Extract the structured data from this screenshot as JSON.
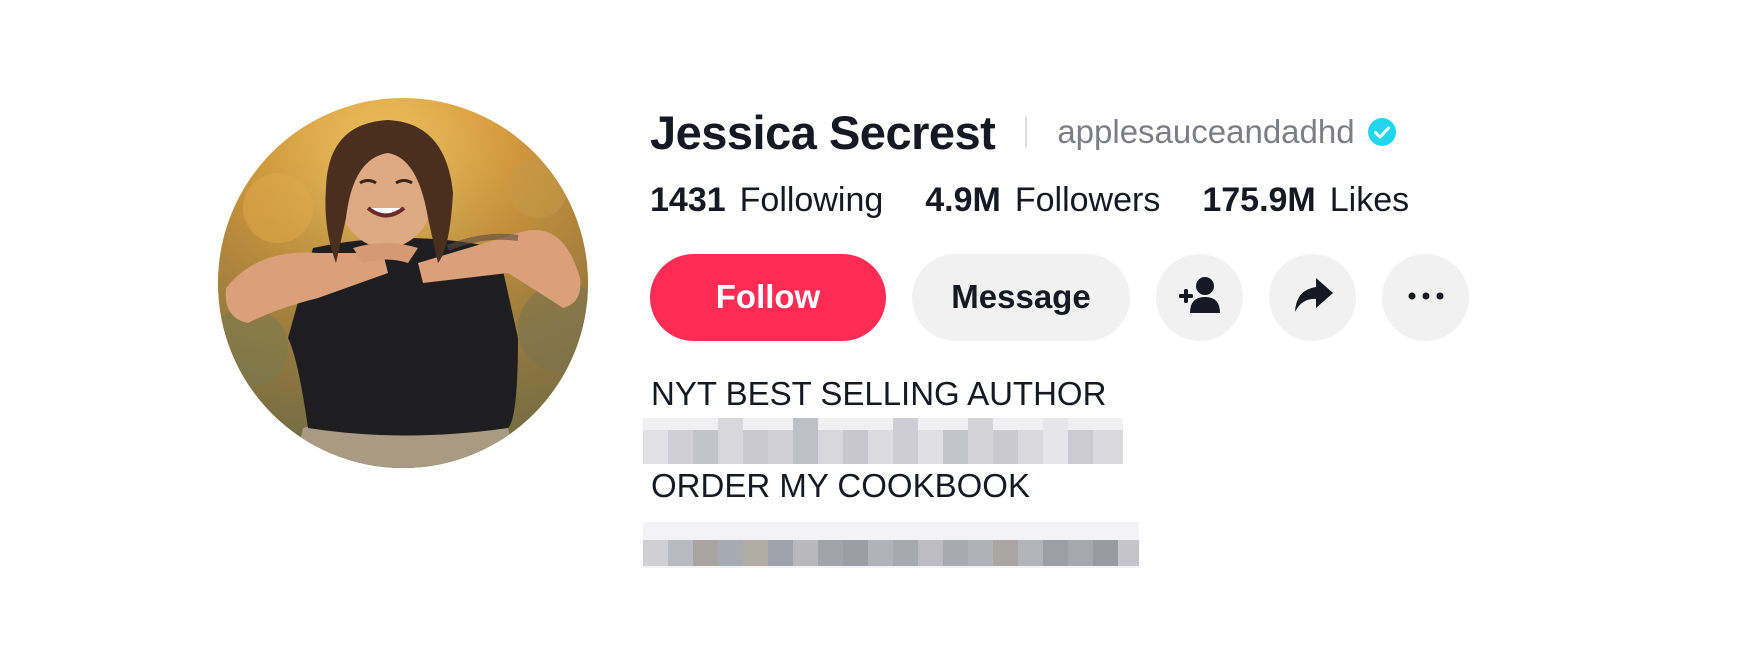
{
  "profile": {
    "display_name": "Jessica Secrest",
    "username": "applesauceandadhd",
    "verified_icon": "verified-check-icon",
    "avatar": "profile-photo"
  },
  "stats": [
    {
      "number": "1431",
      "label": "Following"
    },
    {
      "number": "4.9M",
      "label": "Followers"
    },
    {
      "number": "175.9M",
      "label": "Likes"
    }
  ],
  "actions": {
    "follow_label": "Follow",
    "message_label": "Message",
    "add_friend_icon": "add-user-icon",
    "share_icon": "share-arrow-icon",
    "more_icon": "more-dots-icon"
  },
  "bio": {
    "line1": "NYT BEST SELLING AUTHOR",
    "line2": "ORDER MY COOKBOOK"
  },
  "colors": {
    "follow_bg": "#fe2c55",
    "secondary_bg": "#f1f1f2",
    "verified": "#20d5ec",
    "text_primary": "#161823",
    "text_secondary": "#7d7e85"
  }
}
